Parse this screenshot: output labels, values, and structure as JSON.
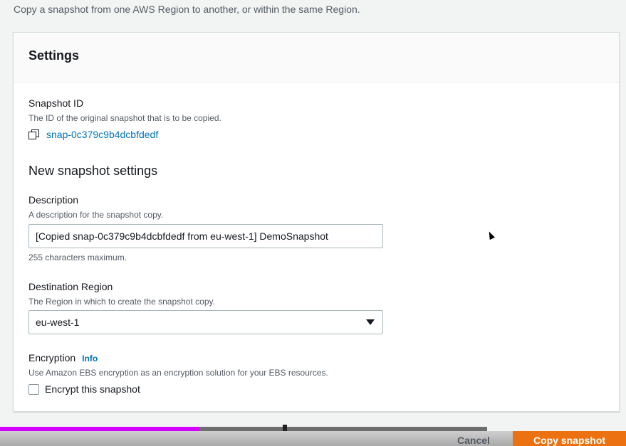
{
  "page": {
    "intro": "Copy a snapshot from one AWS Region to another, or within the same Region."
  },
  "settings": {
    "title": "Settings",
    "snapshot_id": {
      "label": "Snapshot ID",
      "description": "The ID of the original snapshot that is to be copied.",
      "value": "snap-0c379c9b4dcbfdedf",
      "icon": "copy-icon"
    },
    "new_snapshot_heading": "New snapshot settings",
    "description_field": {
      "label": "Description",
      "description": "A description for the snapshot copy.",
      "value": "[Copied snap-0c379c9b4dcbfdedf from eu-west-1] DemoSnapshot",
      "constraint": "255 characters maximum."
    },
    "destination_region": {
      "label": "Destination Region",
      "description": "The Region in which to create the snapshot copy.",
      "selected": "eu-west-1"
    },
    "encryption": {
      "label": "Encryption",
      "info_link": "Info",
      "description": "Use Amazon EBS encryption as an encryption solution for your EBS resources.",
      "checkbox_label": "Encrypt this snapshot",
      "checked": false
    }
  },
  "footer": {
    "cancel_label": "Cancel",
    "submit_label": "Copy snapshot"
  },
  "video_player": {
    "progress_fraction": 0.41
  },
  "colors": {
    "link": "#0073bb",
    "primary_button": "#ec7211",
    "progress": "#d400ff"
  }
}
